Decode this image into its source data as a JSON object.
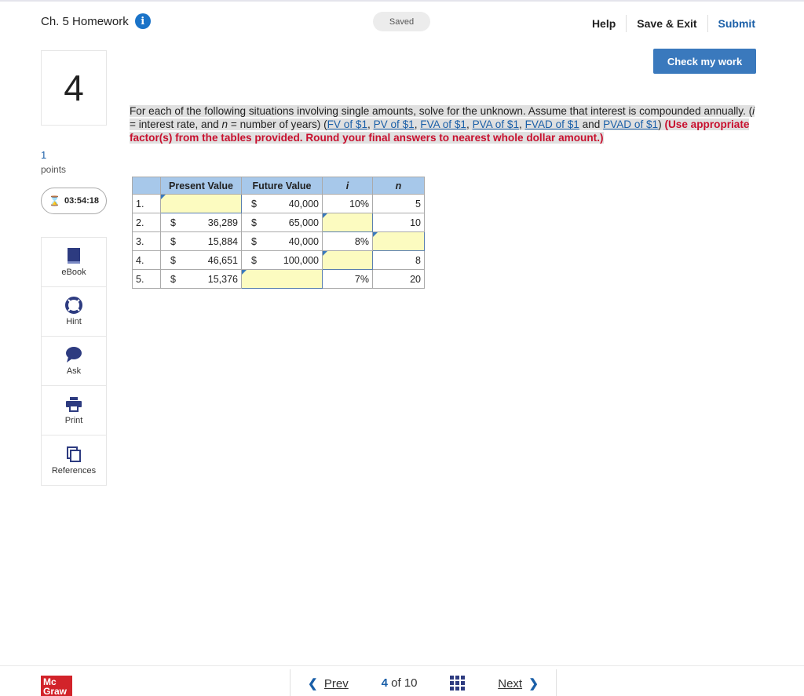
{
  "header": {
    "title": "Ch. 5 Homework",
    "info_glyph": "i",
    "saved": "Saved",
    "help": "Help",
    "save_exit": "Save & Exit",
    "submit": "Submit"
  },
  "question": {
    "number": "4",
    "points_value": "1",
    "points_label": "points",
    "timer": "03:54:18",
    "check_work": "Check my work",
    "text_1": "For each of the following situations involving single amounts, solve for the unknown. Assume that interest is compounded annually. (",
    "i_var": "i",
    "text_2": " = interest rate, and ",
    "n_var": "n",
    "text_3": " = number of years) (",
    "links": [
      "FV of $1",
      "PV of $1",
      "FVA of $1",
      "PVA of $1",
      "FVAD of $1"
    ],
    "and_text": "and",
    "last_link": "PVAD of $1",
    "instruction": "(Use appropriate factor(s) from the tables provided. Round your final answers to nearest whole dollar amount.)"
  },
  "tools": [
    {
      "label": "eBook",
      "icon": "book-icon"
    },
    {
      "label": "Hint",
      "icon": "lifebuoy-icon"
    },
    {
      "label": "Ask",
      "icon": "speech-bubble-icon"
    },
    {
      "label": "Print",
      "icon": "printer-icon"
    },
    {
      "label": "References",
      "icon": "copy-pages-icon"
    }
  ],
  "table": {
    "headers": [
      "",
      "Present Value",
      "Future Value",
      "i",
      "n"
    ],
    "rows": [
      {
        "idx": "1.",
        "pv": "",
        "fv": "40,000",
        "i": "10%",
        "n": "5"
      },
      {
        "idx": "2.",
        "pv": "36,289",
        "fv": "65,000",
        "i": "",
        "n": "10"
      },
      {
        "idx": "3.",
        "pv": "15,884",
        "fv": "40,000",
        "i": "8%",
        "n": ""
      },
      {
        "idx": "4.",
        "pv": "46,651",
        "fv": "100,000",
        "i": "",
        "n": "8"
      },
      {
        "idx": "5.",
        "pv": "15,376",
        "fv": "",
        "i": "7%",
        "n": "20"
      }
    ],
    "currency": "$"
  },
  "footer": {
    "logo_line1": "Mc",
    "logo_line2": "Graw",
    "prev": "Prev",
    "current": "4",
    "of_label": "of",
    "total": "10",
    "next": "Next"
  },
  "colors": {
    "accent": "#1a5fa8",
    "button": "#3a79bd",
    "answer_cell": "#fcfbc0",
    "header_cell": "#a7c8ea",
    "instruction": "#c8102e",
    "logo": "#d2232a"
  }
}
